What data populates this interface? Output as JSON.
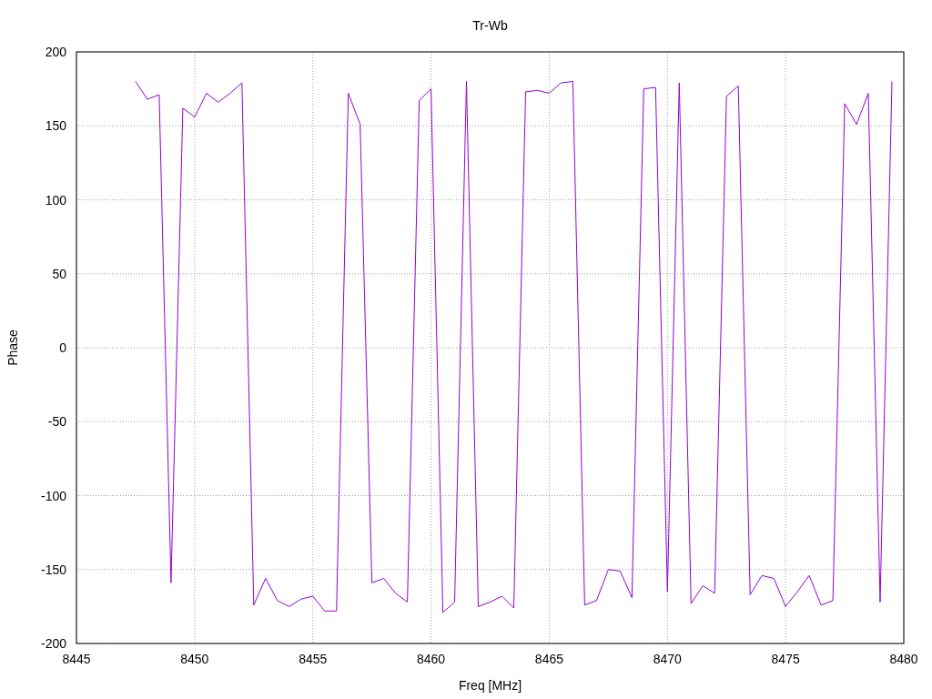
{
  "chart_data": {
    "type": "line",
    "title": "Tr-Wb",
    "xlabel": "Freq [MHz]",
    "ylabel": "Phase",
    "x": [
      8447.5,
      8448,
      8448.5,
      8449,
      8449.5,
      8450,
      8450.5,
      8451,
      8451.5,
      8452,
      8452.5,
      8453,
      8453.5,
      8454,
      8454.5,
      8455,
      8455.5,
      8456,
      8456.5,
      8457,
      8457.5,
      8458,
      8458.5,
      8459,
      8459.5,
      8460,
      8460.5,
      8461,
      8461.5,
      8462,
      8462.5,
      8463,
      8463.5,
      8464,
      8464.5,
      8465,
      8465.5,
      8466,
      8466.5,
      8467,
      8467.5,
      8468,
      8468.5,
      8469,
      8469.5,
      8470,
      8470.5,
      8471,
      8471.5,
      8472,
      8472.5,
      8473,
      8473.5,
      8474,
      8474.5,
      8475,
      8475.5,
      8476,
      8476.5,
      8477,
      8477.5,
      8478,
      8478.5,
      8479,
      8479.5
    ],
    "series": [
      {
        "color": "#9400d3",
        "values": [
          180,
          168,
          171,
          -159,
          162,
          156,
          172,
          166,
          172,
          179,
          -174,
          -156,
          -171,
          -175,
          -170,
          -168,
          -178,
          -178,
          172,
          151,
          -159,
          -156,
          -166,
          -172,
          167,
          175,
          -179,
          -172,
          180,
          -175,
          -172,
          -168,
          -176,
          173,
          174,
          172,
          179,
          180,
          -174,
          -171,
          -150,
          -151,
          -169,
          175,
          176,
          -165,
          179,
          -173,
          -161,
          -166,
          170,
          177,
          -167,
          -154,
          -156,
          -175,
          -165,
          -154,
          -174,
          -171,
          165,
          151,
          172,
          -172,
          180
        ]
      }
    ],
    "grid": true,
    "xlim": [
      8445,
      8480
    ],
    "ylim": [
      -200,
      200
    ],
    "xticks": [
      8445,
      8450,
      8455,
      8460,
      8465,
      8470,
      8475,
      8480
    ],
    "yticks": [
      -200,
      -150,
      -100,
      -50,
      0,
      50,
      100,
      150,
      200
    ]
  }
}
